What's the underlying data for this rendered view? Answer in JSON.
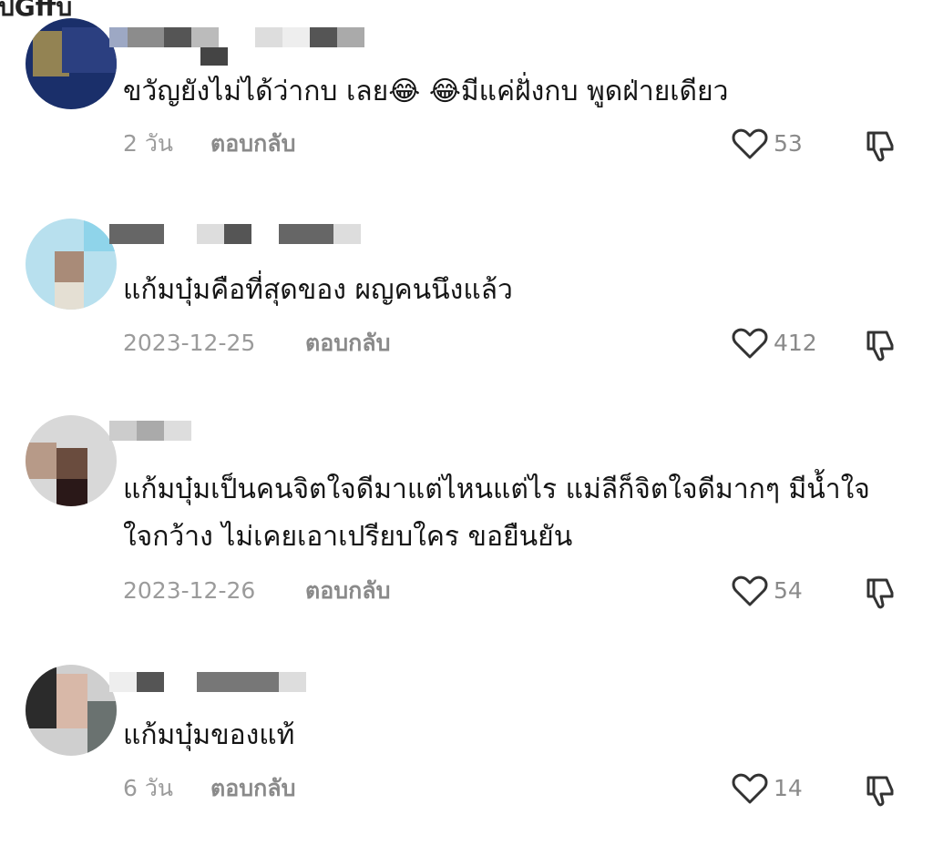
{
  "header_partial_text": "ปGffบ",
  "comments": [
    {
      "text": "ขวัญยังไม่ได้ว่ากบ เลย😂 😂มีแค่ฝั่งกบ พูดฝ่ายเดียว",
      "timestamp": "2 วัน",
      "reply_label": "ตอบกลับ",
      "likes": "53"
    },
    {
      "text": "แก้มบุ๋มคือที่สุดของ ผญคนนึงแล้ว",
      "timestamp": "2023-12-25",
      "reply_label": "ตอบกลับ",
      "likes": "412"
    },
    {
      "text": "แก้มบุ๋มเป็นคนจิตใจดีมาแต่ไหนแต่ไร แม่ลีก็จิตใจดีมากๆ มีน้ำใจ ใจกว้าง ไม่เคยเอาเปรียบใคร ขอยืนยัน",
      "timestamp": "2023-12-26",
      "reply_label": "ตอบกลับ",
      "likes": "54"
    },
    {
      "text": "แก้มบุ๋มของแท้",
      "timestamp": "6 วัน",
      "reply_label": "ตอบกลับ",
      "likes": "14"
    }
  ],
  "icons": {
    "like": "heart-outline-icon",
    "dislike": "thumbs-down-outline-icon"
  },
  "colors": {
    "text": "#151515",
    "muted": "#9b9b9b",
    "icon": "#333333"
  }
}
